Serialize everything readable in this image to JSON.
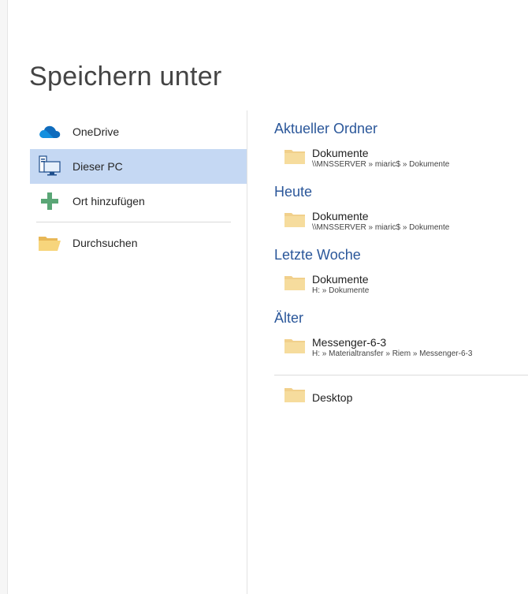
{
  "title": "Speichern unter",
  "nav": {
    "items": [
      {
        "label": "OneDrive",
        "icon": "onedrive-icon"
      },
      {
        "label": "Dieser PC",
        "icon": "computer-icon",
        "selected": true
      },
      {
        "label": "Ort hinzufügen",
        "icon": "add-icon"
      },
      {
        "label": "Durchsuchen",
        "icon": "folder-open-icon"
      }
    ]
  },
  "sections": [
    {
      "heading": "Aktueller Ordner",
      "items": [
        {
          "name": "Dokumente",
          "path": "\\\\MNSSERVER » miaric$ » Dokumente"
        }
      ]
    },
    {
      "heading": "Heute",
      "items": [
        {
          "name": "Dokumente",
          "path": "\\\\MNSSERVER » miaric$ » Dokumente"
        }
      ]
    },
    {
      "heading": "Letzte Woche",
      "items": [
        {
          "name": "Dokumente",
          "path": "H: » Dokumente"
        }
      ]
    },
    {
      "heading": "Älter",
      "items": [
        {
          "name": "Messenger-6-3",
          "path": "H: » Materialtransfer » Riem » Messenger-6-3"
        }
      ]
    }
  ],
  "extra_item": {
    "name": "Desktop"
  },
  "colors": {
    "accent": "#2b579a",
    "selected_bg": "#c5d8f3",
    "folder": "#f1d08b",
    "onedrive": "#0f6cbd",
    "add": "#5aa676"
  }
}
